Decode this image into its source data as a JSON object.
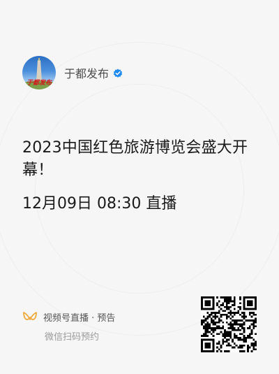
{
  "account": {
    "name": "于都发布",
    "avatar_text": "于都发布",
    "verified_color": "#1f8bf0"
  },
  "live": {
    "title": "2023中国红色旅游博览会盛大开幕！",
    "time": "12月09日 08:30 直播"
  },
  "footer": {
    "channels_label": "视频号直播 · 预告",
    "scan_hint": "微信扫码预约",
    "channels_icon_color": "#f0a93c"
  },
  "icons": {
    "verified": "verified-badge-icon",
    "channels": "channels-butterfly-icon",
    "qr": "qr-code"
  }
}
